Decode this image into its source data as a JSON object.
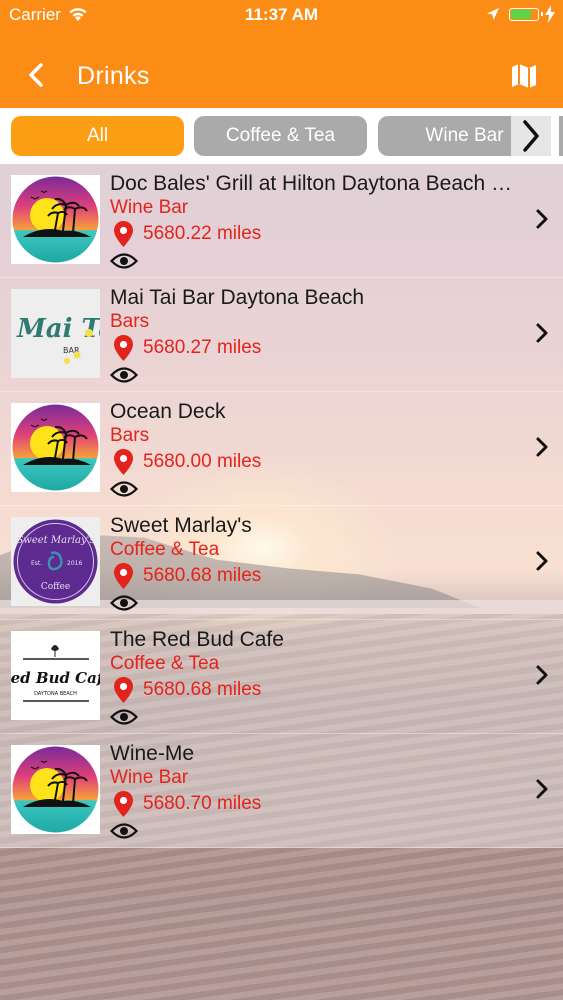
{
  "status_bar": {
    "carrier": "Carrier",
    "time": "11:37 AM"
  },
  "navbar": {
    "title": "Drinks",
    "back_icon": "chevron-left-icon",
    "map_icon": "map-icon"
  },
  "tabs": [
    {
      "label": "All",
      "selected": true
    },
    {
      "label": "Coffee & Tea",
      "selected": false
    },
    {
      "label": "Wine Bar",
      "selected": false
    }
  ],
  "colors": {
    "accent": "#fb8c15",
    "active_tab": "#fb9e13",
    "inactive_tab": "#aaaaaa",
    "category_text": "#e3241d"
  },
  "places": [
    {
      "name": "Doc Bales' Grill at Hilton Daytona Beach Resort",
      "category": "Wine Bar",
      "distance": "5680.22 miles",
      "thumb": "sunset-island-logo"
    },
    {
      "name": "Mai Tai Bar Daytona Beach",
      "category": "Bars",
      "distance": "5680.27 miles",
      "thumb": "mai-tai-bar-logo"
    },
    {
      "name": "Ocean Deck",
      "category": "Bars",
      "distance": "5680.00 miles",
      "thumb": "sunset-island-logo"
    },
    {
      "name": "Sweet Marlay's",
      "category": "Coffee & Tea",
      "distance": "5680.68 miles",
      "thumb": "sweet-marlays-logo"
    },
    {
      "name": "The Red Bud Cafe",
      "category": "Coffee & Tea",
      "distance": "5680.68 miles",
      "thumb": "red-bud-cafe-logo"
    },
    {
      "name": "Wine-Me",
      "category": "Wine Bar",
      "distance": "5680.70 miles",
      "thumb": "sunset-island-logo"
    }
  ],
  "logo_text": {
    "mai_tai": "Mai Tai",
    "mai_tai_sub": "BAR",
    "sweet_marlays": "Sweet Marlay's",
    "sweet_marlays_est": "Est.",
    "sweet_marlays_year": "2016",
    "sweet_marlays_coffee": "Coffee",
    "red_bud": "Red Bud Cafe",
    "red_bud_sub": "DAYTONA BEACH"
  }
}
